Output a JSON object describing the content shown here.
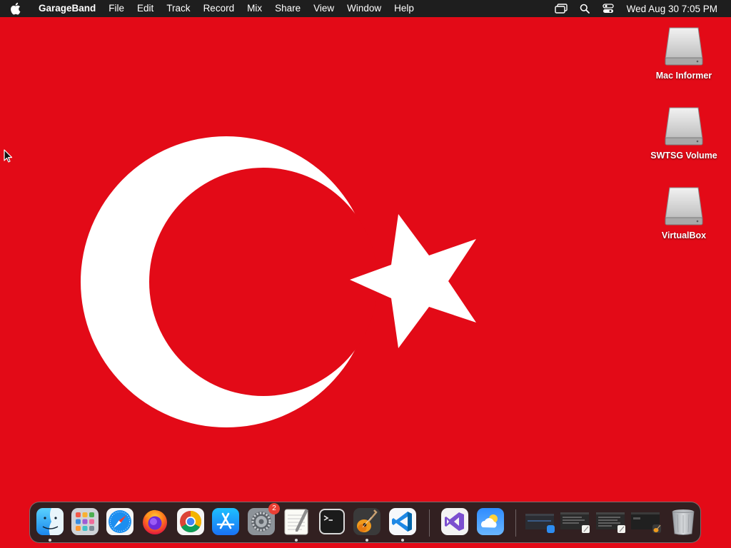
{
  "menubar": {
    "app_name": "GarageBand",
    "menus": [
      "File",
      "Edit",
      "Track",
      "Record",
      "Mix",
      "Share",
      "View",
      "Window",
      "Help"
    ],
    "clock": "Wed Aug 30  7:05 PM",
    "status_icons": [
      "screen-mirroring-icon",
      "search-icon",
      "control-center-icon"
    ]
  },
  "desktop": {
    "wallpaper": "Flag of Turkey",
    "colors": {
      "red": "#e30a17",
      "white": "#ffffff"
    },
    "icons": [
      {
        "label": "Mac Informer",
        "icon": "drive-icon"
      },
      {
        "label": "SWTSG Volume",
        "icon": "drive-icon"
      },
      {
        "label": "VirtualBox",
        "icon": "drive-icon"
      }
    ]
  },
  "dock": {
    "apps": [
      {
        "name": "Finder",
        "running": true
      },
      {
        "name": "Launchpad",
        "running": false
      },
      {
        "name": "Safari",
        "running": false
      },
      {
        "name": "Firefox",
        "running": false
      },
      {
        "name": "Google Chrome",
        "running": false
      },
      {
        "name": "App Store",
        "running": false
      },
      {
        "name": "System Settings",
        "running": false,
        "badge": "2"
      },
      {
        "name": "TextEdit",
        "running": true
      },
      {
        "name": "Terminal",
        "running": false
      },
      {
        "name": "GarageBand",
        "running": true
      },
      {
        "name": "Visual Studio Code",
        "running": true
      },
      {
        "name": "Visual Studio",
        "running": false
      },
      {
        "name": "Weather",
        "running": false
      }
    ],
    "minimized_windows": [
      "Finder window",
      "TextEdit window",
      "TextEdit window",
      "GarageBand window"
    ],
    "trash": "Trash"
  }
}
